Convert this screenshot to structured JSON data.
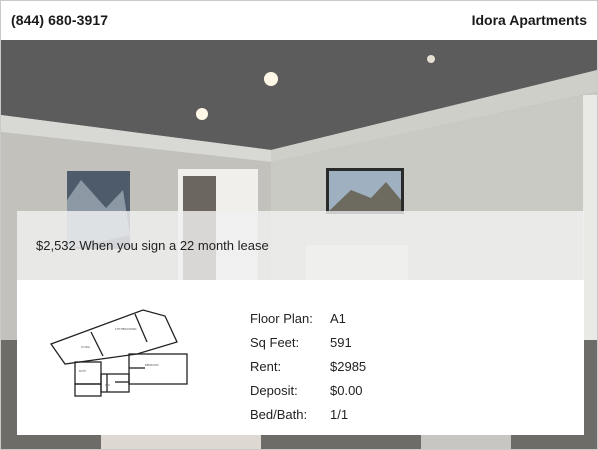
{
  "header": {
    "phone": "(844) 680-3917",
    "brand": "Idora Apartments"
  },
  "promo": {
    "text": "$2,532 When you sign a 22 month lease"
  },
  "unit": {
    "rows": [
      {
        "label": "Floor Plan:",
        "value": "A1"
      },
      {
        "label": "Sq Feet:",
        "value": "591"
      },
      {
        "label": "Rent:",
        "value": "$2985"
      },
      {
        "label": "Deposit:",
        "value": "$0.00"
      },
      {
        "label": "Bed/Bath:",
        "value": "1/1"
      }
    ]
  },
  "icons": {
    "floorplan": "floorplan-drawing"
  }
}
